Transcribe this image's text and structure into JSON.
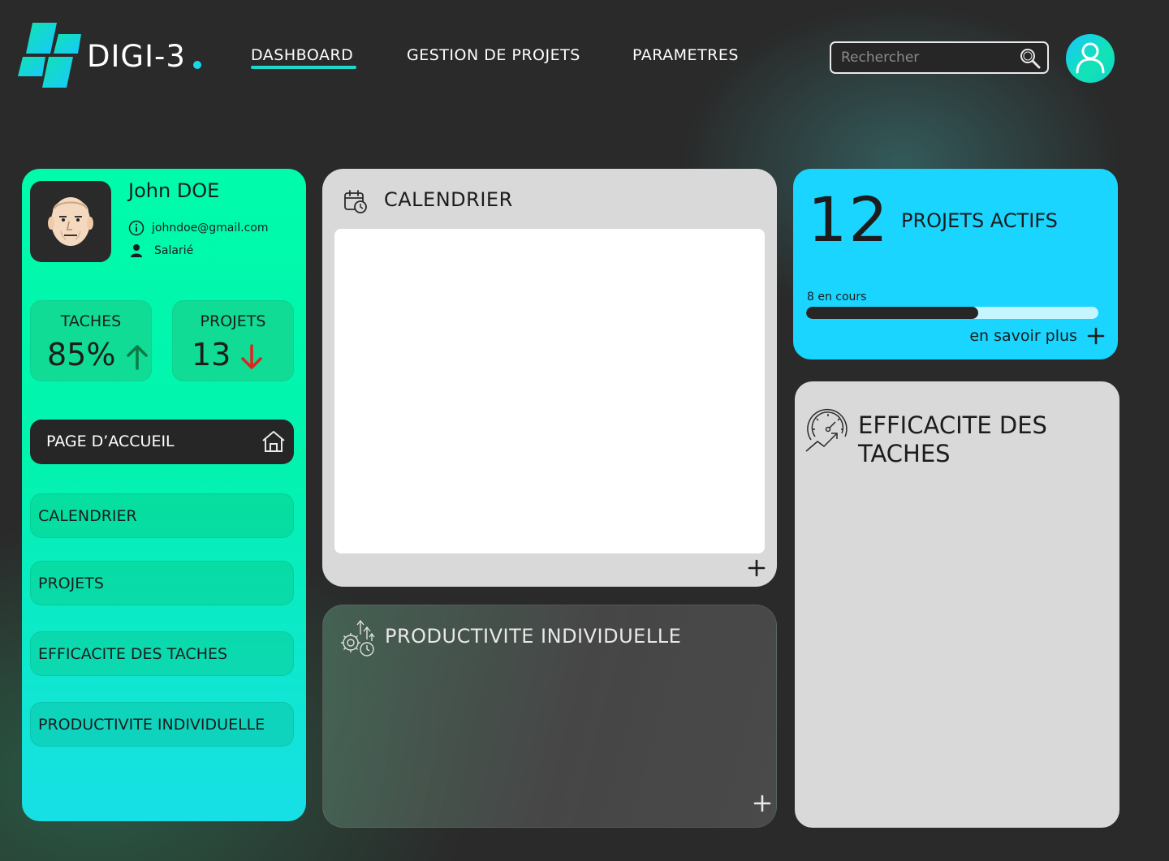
{
  "header": {
    "brand": "DIGI-3",
    "nav": [
      {
        "label": "DASHBOARD",
        "active": true
      },
      {
        "label": "GESTION DE PROJETS",
        "active": false
      },
      {
        "label": "PARAMETRES",
        "active": false
      }
    ],
    "search": {
      "placeholder": "Rechercher",
      "value": ""
    }
  },
  "colors": {
    "accent_green": "#00fcab",
    "accent_cyan": "#19d5ff",
    "background": "#2a2a2a",
    "card_gray": "#d9d9d9",
    "arrow_up": "#0b7a45",
    "arrow_down": "#e0231f"
  },
  "icons": {
    "search": "search-icon",
    "user": "user-icon",
    "home": "home-icon",
    "calendar": "calendar-clock-icon",
    "productivity": "gear-growth-icon",
    "efficiency": "speedometer-icon"
  },
  "profile": {
    "name": "John DOE",
    "email": "johndoe@gmail.com",
    "role": "Salarié"
  },
  "stats": {
    "taches": {
      "label": "TACHES",
      "value": "85%",
      "trend": "up"
    },
    "projets": {
      "label": "PROJETS",
      "value": "13",
      "trend": "down"
    }
  },
  "sidebar": {
    "home": "PAGE D’ACCUEIL",
    "items": [
      {
        "label": "CALENDRIER"
      },
      {
        "label": "PROJETS"
      },
      {
        "label": "EFFICACITE DES TACHES"
      },
      {
        "label": "PRODUCTIVITE INDIVIDUELLE"
      }
    ]
  },
  "calendar": {
    "title": "CALENDRIER"
  },
  "productivite": {
    "title": "PRODUCTIVITE INDIVIDUELLE"
  },
  "projets_actifs": {
    "count": "12",
    "label": "PROJETS ACTIFS",
    "progress_label": "8 en cours",
    "progress_fraction": 0.59,
    "more": "en savoir plus"
  },
  "efficacite": {
    "title": "EFFICACITE DES TACHES"
  }
}
